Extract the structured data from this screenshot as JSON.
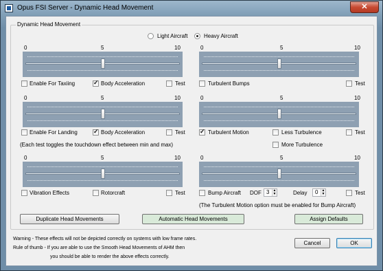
{
  "window": {
    "title": "Opus FSI Server - Dynamic Head Movement",
    "close_label": "✕"
  },
  "group": {
    "label": "Dynamic Head Movement"
  },
  "aircraft": {
    "light_label": "Light Aircraft",
    "light_selected": false,
    "heavy_label": "Heavy Aircraft",
    "heavy_selected": true
  },
  "scale": {
    "min": "0",
    "mid": "5",
    "max": "10"
  },
  "sliders": {
    "taxiing": 5,
    "turbulent_bumps": 5,
    "landing": 5,
    "turbulent_motion": 5,
    "vibration": 5,
    "bump_aircraft": 5
  },
  "row1": {
    "enable_taxiing": "Enable For Taxiing",
    "enable_taxiing_checked": false,
    "body_accel": "Body Acceleration",
    "body_accel_checked": true,
    "test": "Test",
    "test_checked": false,
    "turbulent_bumps": "Turbulent Bumps",
    "turbulent_bumps_checked": false,
    "test2": "Test",
    "test2_checked": false
  },
  "row2": {
    "enable_landing": "Enable For Landing",
    "enable_landing_checked": false,
    "body_accel": "Body Acceleration",
    "body_accel_checked": true,
    "test": "Test",
    "test_checked": false,
    "turbulent_motion": "Turbulent Motion",
    "turbulent_motion_checked": true,
    "less_turbulence": "Less Turbulence",
    "less_turbulence_checked": false,
    "test2": "Test",
    "test2_checked": false,
    "more_turbulence": "More Turbulence",
    "more_turbulence_checked": false,
    "note": "(Each test toggles the touchdown effect between min and max)"
  },
  "row3": {
    "vibration": "Vibration Effects",
    "vibration_checked": false,
    "rotorcraft": "Rotorcraft",
    "rotorcraft_checked": false,
    "test": "Test",
    "test_checked": false,
    "bump_aircraft": "Bump Aircraft",
    "bump_aircraft_checked": false,
    "dof_label": "DOF",
    "dof_value": "3",
    "delay_label": "Delay",
    "delay_value": "0",
    "test2": "Test",
    "test2_checked": false,
    "note": "(The Turbulent Motion option must be enabled for Bump Aircraft)"
  },
  "buttons": {
    "duplicate": "Duplicate Head Movements",
    "automatic": "Automatic Head Movements",
    "defaults": "Assign Defaults",
    "cancel": "Cancel",
    "ok": "OK"
  },
  "footer": {
    "warning": "Warning - These effects will not be depicted correctly on systems with low frame rates.",
    "rule1": "Rule of thumb - If you are able to use the Smooth Head Movements of AHM then",
    "rule2": "you should be able to render the above effects correctly."
  },
  "colors": {
    "slider_bg": "#8ea0b2",
    "automatic_button_bg": "#d9ead9",
    "defaults_button_bg": "#d9ead9"
  }
}
